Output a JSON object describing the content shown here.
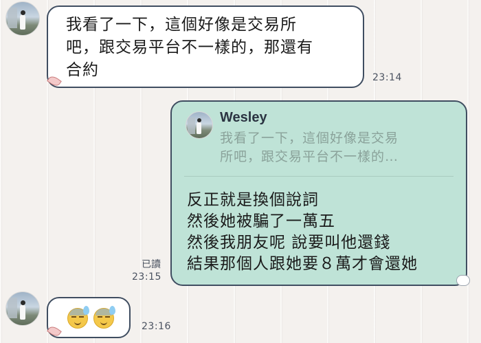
{
  "messages": [
    {
      "type": "incoming",
      "lines": [
        "我看了一下，這個好像是交易所",
        "吧，跟交易平台不一樣的，那還有",
        "合約"
      ],
      "time": "23:14"
    },
    {
      "type": "outgoing",
      "reply": {
        "name": "Wesley",
        "quote_lines": [
          "我看了一下，這個好像是交易",
          "所吧，跟交易平台不一樣的…"
        ]
      },
      "lines": [
        "反正就是換個說詞",
        "然後她被騙了一萬五",
        "然後我朋友呢 說要叫他還錢",
        "結果那個人跟她要８萬才會還她"
      ],
      "read": "已讀",
      "time": "23:15"
    },
    {
      "type": "incoming",
      "emojis": [
        "sweat-face-icon",
        "sweat-face-icon"
      ],
      "time": "23:16"
    }
  ],
  "colors": {
    "incoming_bubble": "#ffffff",
    "outgoing_bubble": "#bfe3d7",
    "bubble_border": "#3f4d60",
    "timestamp": "#4a5260"
  }
}
